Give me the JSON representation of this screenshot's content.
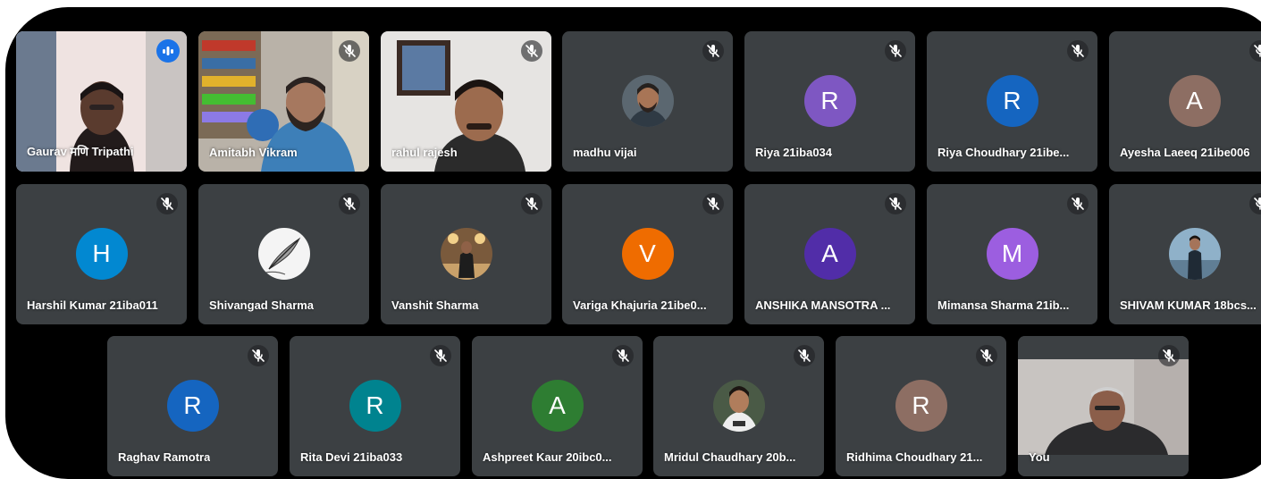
{
  "participants": [
    {
      "name": "Gaurav मणि Tripathi",
      "initial": "",
      "color": "",
      "video": "gaurav",
      "status": "speaking"
    },
    {
      "name": "Amitabh Vikram",
      "initial": "",
      "color": "",
      "video": "amitabh",
      "status": "muted"
    },
    {
      "name": "rahul rajesh",
      "initial": "",
      "color": "",
      "video": "rahul",
      "status": "muted"
    },
    {
      "name": "madhu vijai",
      "initial": "",
      "color": "",
      "photo": "madhu",
      "status": "muted"
    },
    {
      "name": "Riya 21iba034",
      "initial": "R",
      "color": "#7e57c2",
      "status": "muted"
    },
    {
      "name": "Riya Choudhary 21ibe...",
      "initial": "R",
      "color": "#1565c0",
      "status": "muted"
    },
    {
      "name": "Ayesha Laeeq 21ibe006",
      "initial": "A",
      "color": "#8d6e63",
      "status": "muted"
    },
    {
      "name": "Harshil Kumar 21iba011",
      "initial": "H",
      "color": "#0288d1",
      "status": "muted"
    },
    {
      "name": "Shivangad Sharma",
      "initial": "",
      "color": "",
      "photo": "quill",
      "status": "muted"
    },
    {
      "name": "Vanshit Sharma",
      "initial": "",
      "color": "",
      "photo": "vanshit",
      "status": "muted"
    },
    {
      "name": "Variga Khajuria 21ibe0...",
      "initial": "V",
      "color": "#ef6c00",
      "status": "muted"
    },
    {
      "name": "ANSHIKA MANSOTRA ...",
      "initial": "A",
      "color": "#512da8",
      "status": "muted"
    },
    {
      "name": "Mimansa Sharma 21ib...",
      "initial": "M",
      "color": "#9c5ee0",
      "status": "muted"
    },
    {
      "name": "SHIVAM KUMAR 18bcs...",
      "initial": "",
      "color": "",
      "photo": "shivam",
      "status": "muted"
    },
    {
      "name": "Raghav Ramotra",
      "initial": "R",
      "color": "#1565c0",
      "status": "muted"
    },
    {
      "name": "Rita Devi 21iba033",
      "initial": "R",
      "color": "#00838f",
      "status": "muted"
    },
    {
      "name": "Ashpreet Kaur 20ibc0...",
      "initial": "A",
      "color": "#2e7d32",
      "status": "muted"
    },
    {
      "name": "Mridul Chaudhary 20b...",
      "initial": "",
      "color": "",
      "photo": "mridul",
      "status": "muted"
    },
    {
      "name": "Ridhima Choudhary 21...",
      "initial": "R",
      "color": "#8d6e63",
      "status": "muted"
    },
    {
      "name": "You",
      "initial": "",
      "color": "",
      "video": "you",
      "status": "muted"
    }
  ]
}
